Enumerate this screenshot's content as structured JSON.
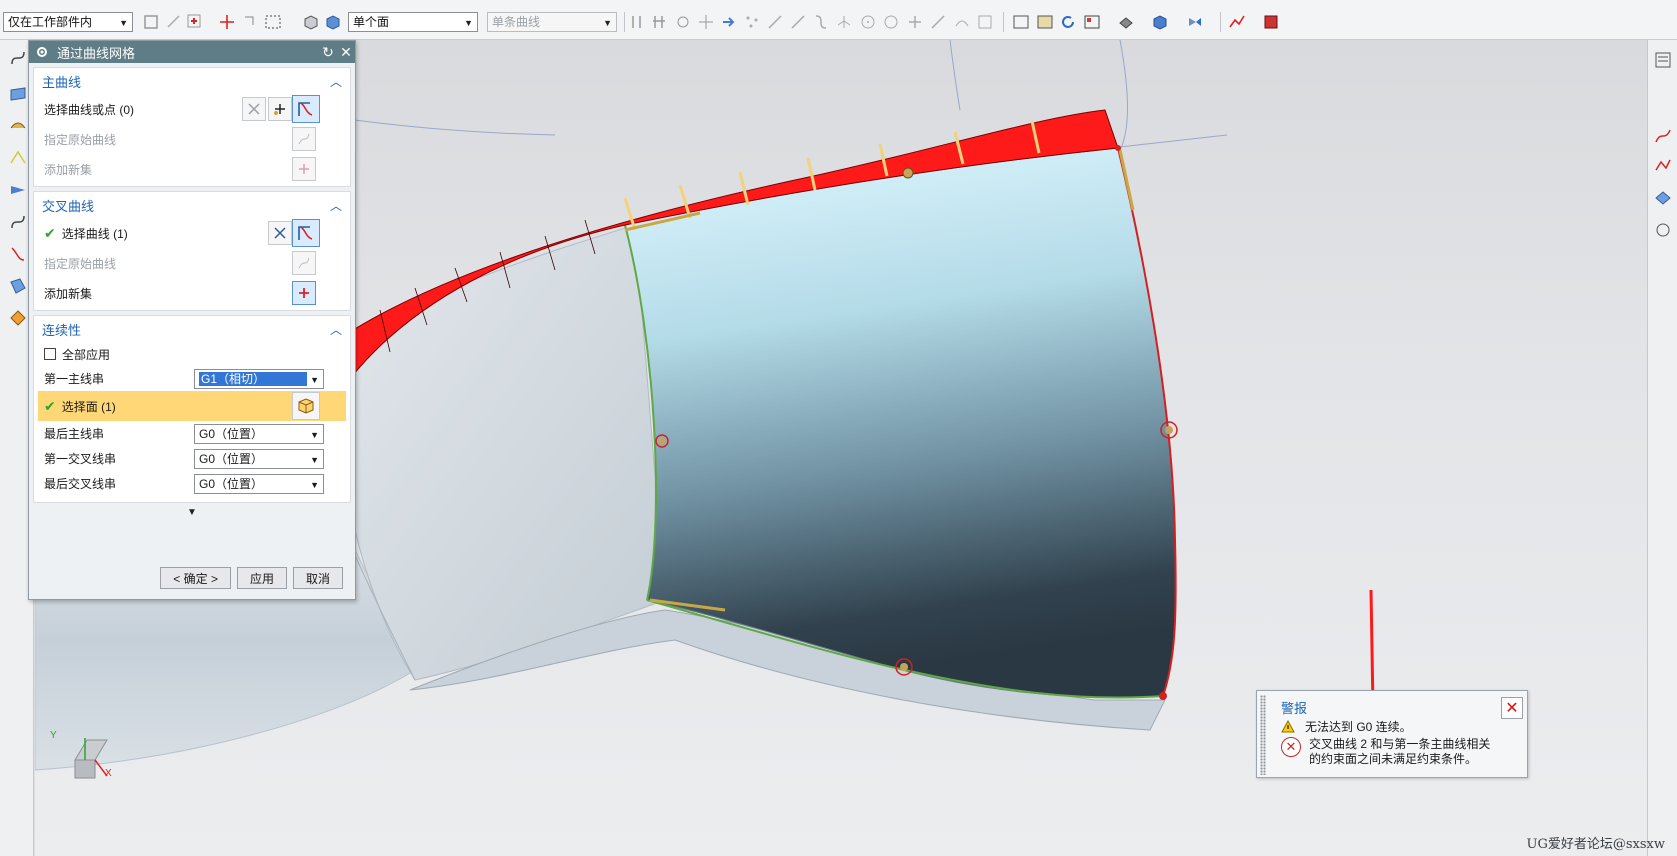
{
  "toolbar": {
    "filter_select": "仅在工作部件内",
    "face_rule_select": "单个面",
    "curve_rule_select": "单条曲线"
  },
  "dialog": {
    "title": "通过曲线网格",
    "primary": {
      "header": "主曲线",
      "select_label": "选择曲线或点 (0)",
      "specify_label": "指定原始曲线",
      "add_label": "添加新集"
    },
    "cross": {
      "header": "交叉曲线",
      "select_label": "选择曲线 (1)",
      "specify_label": "指定原始曲线",
      "add_label": "添加新集"
    },
    "continuity": {
      "header": "连续性",
      "apply_all_label": "全部应用",
      "first_primary_label": "第一主线串",
      "first_primary_value": "G1（相切）",
      "select_face_label": "选择面 (1)",
      "last_primary_label": "最后主线串",
      "last_primary_value": "G0（位置）",
      "first_cross_label": "第一交叉线串",
      "first_cross_value": "G0（位置）",
      "last_cross_label": "最后交叉线串",
      "last_cross_value": "G0（位置）"
    },
    "buttons": {
      "ok": "< 确定 >",
      "apply": "应用",
      "cancel": "取消"
    }
  },
  "alert": {
    "title": "警报",
    "warning": "无法达到 G0 连续。",
    "error": "交叉曲线 2 和与第一条主曲线相关的约束面之间未满足约束条件。",
    "close": "✕"
  },
  "axes": {
    "y": "Y",
    "x": "X"
  },
  "watermark": "UG爱好者论坛@sxsxw",
  "colors": {
    "title_bar": "#5f7d87",
    "group_header": "#1e64b4",
    "highlight_row": "#ffd777",
    "surface_strip": "#ff1a1a"
  }
}
